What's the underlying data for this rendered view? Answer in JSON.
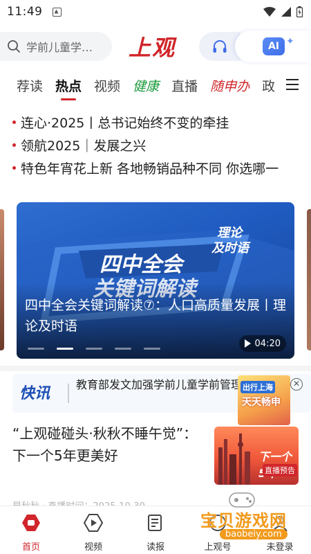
{
  "status_bar": {
    "time": "11:49"
  },
  "header": {
    "search_placeholder": "学前儿童学…",
    "logo_text": "上观",
    "ai_label": "AI"
  },
  "tabs": [
    {
      "label": "荐读"
    },
    {
      "label": "热点"
    },
    {
      "label": "视频"
    },
    {
      "label": "健康"
    },
    {
      "label": "直播"
    },
    {
      "label": "随申办"
    },
    {
      "label": "政"
    }
  ],
  "headlines": [
    {
      "text": "连心·2025丨总书记始终不变的牵挂"
    },
    {
      "text": "领航2025｜发展之兴"
    },
    {
      "text": "特色年宵花上新 各地畅销品种不同 你选哪一"
    }
  ],
  "carousel": {
    "title": "四中全会关键词解读⑦：人口高质量发展丨理论及时语",
    "art_main": "四中全会",
    "art_sub": "关键词解读",
    "art_badge_1": "理论",
    "art_badge_2": "及时语",
    "duration": "04:20",
    "slide_count": 5,
    "active_slide": 2
  },
  "news_flash": {
    "logo": "快讯",
    "text": "教育部发文加强学前儿童学前管理",
    "ad_tag": "出行上海",
    "ad_title": "天天畅申"
  },
  "article": {
    "title": "“上观碰碰头·秋秋不睡午觉”：下一个5年更美好",
    "thumb_text": "下一个5年",
    "thumb_sub": "直播预告",
    "meta": "早秋秋 · 直播时间：2025-10-30"
  },
  "bottom_nav": [
    {
      "label": "首页"
    },
    {
      "label": "视频"
    },
    {
      "label": "读报"
    },
    {
      "label": "上观号"
    },
    {
      "label": "未登录"
    }
  ],
  "watermark": {
    "text": "宝贝游戏网",
    "url": "baobeiy.com"
  },
  "colors": {
    "brand_red": "#d0262b",
    "health_green": "#1a9a3a",
    "flash_blue": "#1d4fb6"
  }
}
